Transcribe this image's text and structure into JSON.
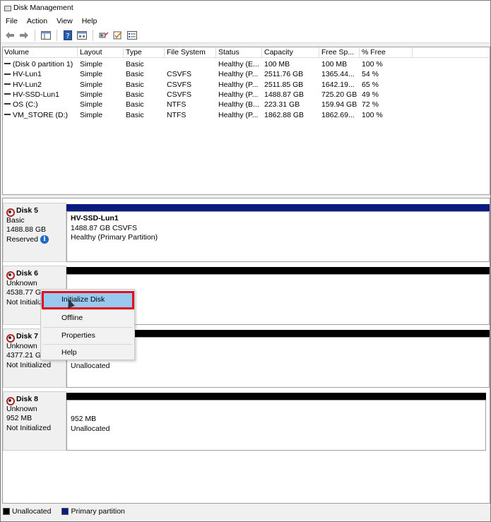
{
  "window": {
    "title": "Disk Management"
  },
  "menubar": {
    "items": [
      "File",
      "Action",
      "View",
      "Help"
    ]
  },
  "toolbar": {
    "icons": [
      "back-arrow-icon",
      "forward-arrow-icon",
      "show-hide-pane-icon",
      "help-icon",
      "properties-icon",
      "connect-icon",
      "check-icon",
      "list-icon"
    ]
  },
  "volume_list": {
    "columns": [
      "Volume",
      "Layout",
      "Type",
      "File System",
      "Status",
      "Capacity",
      "Free Sp...",
      "% Free"
    ],
    "rows": [
      [
        "(Disk 0 partition 1)",
        "Simple",
        "Basic",
        "",
        "Healthy (E...",
        "100 MB",
        "100 MB",
        "100 %"
      ],
      [
        "HV-Lun1",
        "Simple",
        "Basic",
        "CSVFS",
        "Healthy (P...",
        "2511.76 GB",
        "1365.44...",
        "54 %"
      ],
      [
        "HV-Lun2",
        "Simple",
        "Basic",
        "CSVFS",
        "Healthy (P...",
        "2511.85 GB",
        "1642.19...",
        "65 %"
      ],
      [
        "HV-SSD-Lun1",
        "Simple",
        "Basic",
        "CSVFS",
        "Healthy (P...",
        "1488.87 GB",
        "725.20 GB",
        "49 %"
      ],
      [
        "OS (C:)",
        "Simple",
        "Basic",
        "NTFS",
        "Healthy (B...",
        "223.31 GB",
        "159.94 GB",
        "72 %"
      ],
      [
        "VM_STORE (D:)",
        "Simple",
        "Basic",
        "NTFS",
        "Healthy (P...",
        "1862.88 GB",
        "1862.69...",
        "100 %"
      ]
    ]
  },
  "disks": [
    {
      "name": "Disk 5",
      "type": "Basic",
      "size": "1488.88 GB",
      "status": "Reserved",
      "has_info_icon": true,
      "partition": {
        "title": "HV-SSD-Lun1",
        "detail": "1488.87 GB CSVFS",
        "status": "Healthy (Primary Partition)"
      },
      "bar_color": "#0a1a80"
    },
    {
      "name": "Disk 6",
      "type": "Unknown",
      "size": "4538.77 GB",
      "status": "Not Initialized",
      "has_info_icon": false,
      "partition": {
        "title": "",
        "detail": "",
        "status": ""
      },
      "bar_color": "#000000"
    },
    {
      "name": "Disk 7",
      "type": "Unknown",
      "size": "4377.21 GB",
      "status": "Not Initialized",
      "has_info_icon": false,
      "partition": {
        "title": "",
        "detail": "",
        "status": "Unallocated"
      },
      "bar_color": "#000000"
    },
    {
      "name": "Disk 8",
      "type": "Unknown",
      "size": "952 MB",
      "status": "Not Initialized",
      "has_info_icon": false,
      "partition": {
        "title": "",
        "detail": "952 MB",
        "status": "Unallocated"
      },
      "bar_color": "#000000"
    }
  ],
  "context_menu": {
    "items": [
      "Initialize Disk",
      "Offline",
      "Properties",
      "Help"
    ],
    "highlighted": "Initialize Disk",
    "highlight_color": "#99c9ef",
    "callout_color": "#e01020"
  },
  "legend": {
    "items": [
      {
        "label": "Unallocated",
        "color": "#000000"
      },
      {
        "label": "Primary partition",
        "color": "#0a1a80"
      }
    ]
  }
}
